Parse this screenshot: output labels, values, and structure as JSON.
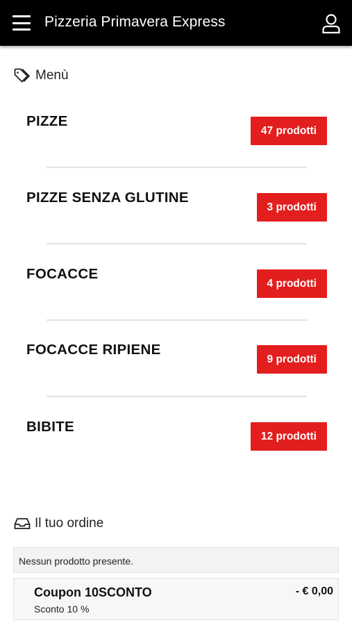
{
  "header": {
    "title": "Pizzeria Primavera Express",
    "menu_icon": "hamburger-menu-icon",
    "account_icon": "user-icon"
  },
  "menu_section": {
    "icon": "tag-icon",
    "label": "Menù"
  },
  "categories": [
    {
      "name": "PIZZE",
      "count": "47 prodotti"
    },
    {
      "name": "PIZZE SENZA GLUTINE",
      "count": "3 prodotti"
    },
    {
      "name": "FOCACCE",
      "count": "4 prodotti"
    },
    {
      "name": "FOCACCE RIPIENE",
      "count": "9 prodotti"
    },
    {
      "name": "BIBITE",
      "count": "12 prodotti"
    }
  ],
  "order_section": {
    "icon": "inbox-icon",
    "label": "Il tuo ordine",
    "empty_message": "Nessun prodotto presente.",
    "coupon": {
      "title": "Coupon 10SCONTO",
      "description": "Sconto 10 %",
      "amount": "- € 0,00"
    }
  },
  "colors": {
    "header_bg": "#000000",
    "accent": "#e31e1e"
  }
}
